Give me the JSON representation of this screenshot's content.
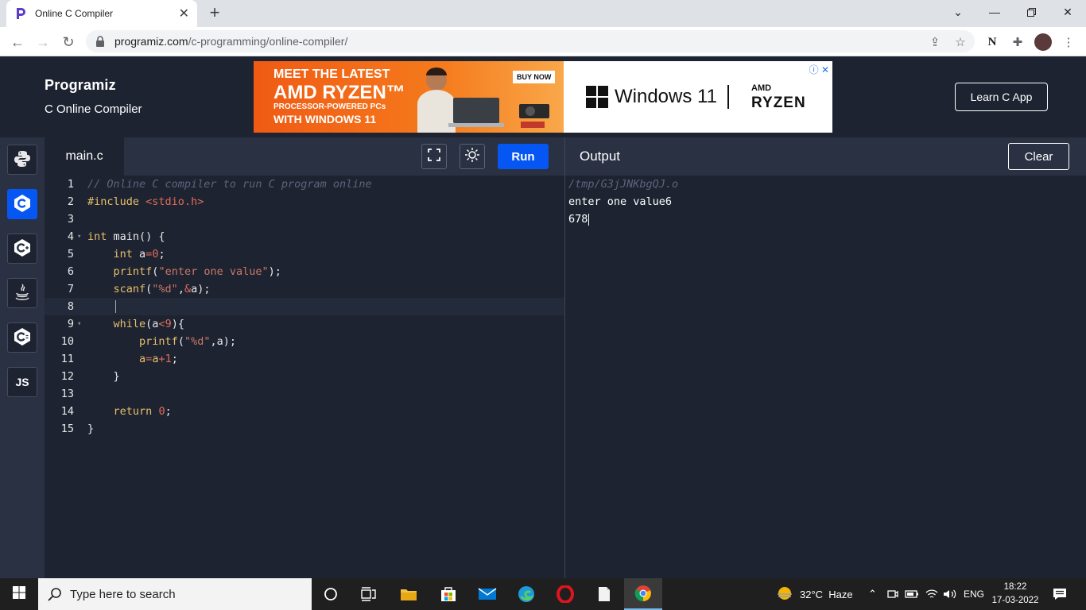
{
  "browser": {
    "tab_title": "Online C Compiler",
    "url_domain": "programiz.com",
    "url_path": "/c-programming/online-compiler/"
  },
  "header": {
    "logo_text": "Programiz",
    "subtitle": "C Online Compiler",
    "learn_button": "Learn C App"
  },
  "ad": {
    "line1": "MEET THE LATEST",
    "line2": "AMD RYZEN™",
    "line3": "PROCESSOR-POWERED PCs",
    "line4": "WITH WINDOWS 11",
    "buy_now": "BUY NOW",
    "windows": "Windows 11",
    "amd": "AMD",
    "ryzen": "RYZEN"
  },
  "sidebar": {
    "items": [
      {
        "name": "python",
        "label": ""
      },
      {
        "name": "c",
        "label": "C"
      },
      {
        "name": "cpp",
        "label": "C+"
      },
      {
        "name": "java",
        "label": ""
      },
      {
        "name": "csharp",
        "label": "C#"
      },
      {
        "name": "javascript",
        "label": "JS"
      }
    ]
  },
  "editor": {
    "file_name": "main.c",
    "run_label": "Run",
    "line_numbers": [
      "1",
      "2",
      "3",
      "4",
      "5",
      "6",
      "7",
      "8",
      "9",
      "10",
      "11",
      "12",
      "13",
      "14",
      "15"
    ]
  },
  "output": {
    "title": "Output",
    "clear_label": "Clear",
    "path": "/tmp/G3jJNKbgQJ.o",
    "line1": "enter one value6",
    "line2": "678"
  },
  "taskbar": {
    "search_placeholder": "Type here to search",
    "weather": "32°C  Haze",
    "language": "ENG",
    "time": "18:22",
    "date": "17-03-2022"
  }
}
